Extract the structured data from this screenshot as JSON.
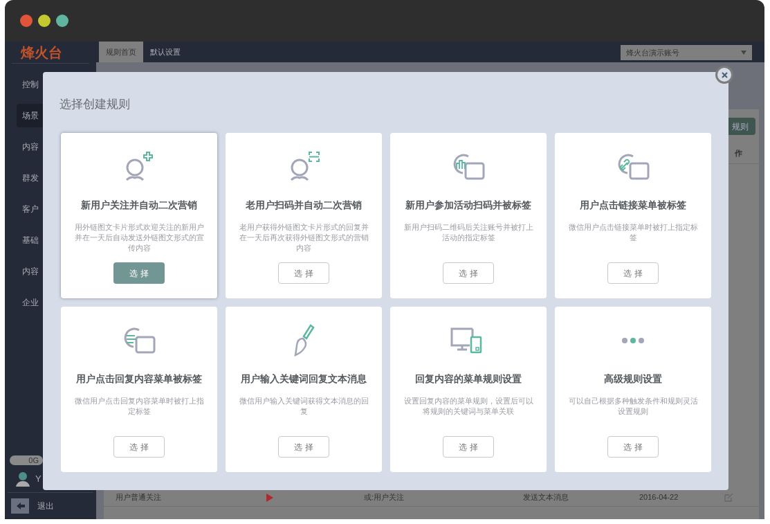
{
  "window": {
    "controls": [
      {
        "color": "#e0553a"
      },
      {
        "color": "#c4c92f"
      },
      {
        "color": "#5fb5a0"
      }
    ]
  },
  "logo": "烽火台",
  "sidebar": {
    "items": [
      {
        "label": "控制",
        "selected": false
      },
      {
        "label": "场景",
        "selected": true
      },
      {
        "label": "内容",
        "selected": false
      },
      {
        "label": "群发",
        "selected": false
      },
      {
        "label": "客户",
        "selected": false
      },
      {
        "label": "基础",
        "selected": false
      },
      {
        "label": "内容",
        "selected": false
      },
      {
        "label": "企业",
        "selected": false
      }
    ],
    "storage": "0G",
    "user": "Y",
    "logout": "退出"
  },
  "top_nav": {
    "tabs": [
      {
        "label": "规则首页",
        "selected": true
      },
      {
        "label": "默认设置",
        "selected": false
      }
    ],
    "account_select": {
      "value": "烽火台演示账号"
    }
  },
  "background": {
    "button": "规则",
    "column_header": "作",
    "row": {
      "cells": [
        "用户普通关注",
        "或:用户关注",
        "发送文本消息",
        "2016-04-22"
      ]
    }
  },
  "dialog": {
    "title": "选择创建规则",
    "cards": [
      {
        "kind": "user-plus",
        "title": "新用户关注并自动二次营销",
        "description": "用外链图文卡片形式欢迎关注的新用户并在一天后自动发送外链图文形式的宣传内容",
        "button": "选 择",
        "selected": true
      },
      {
        "kind": "user-scan",
        "title": "老用户扫码并自动二次营销",
        "description": "老用户获得外链图文卡片形式的回复并在一天后再次获得外链图文形式的营销内容",
        "button": "选 择",
        "selected": false
      },
      {
        "kind": "chart-chat",
        "title": "新用户参加活动扫码并被标签",
        "description": "新用户扫码二维码后关注账号并被打上活动的指定标签",
        "button": "选 择",
        "selected": false
      },
      {
        "kind": "link-chat",
        "title": "用户点击链接菜单被标签",
        "description": "微信用户点击链接菜单时被打上指定标签",
        "button": "选 择",
        "selected": false
      },
      {
        "kind": "text-chat",
        "title": "用户点击回复内容菜单被标签",
        "description": "微信用户点击回复内容菜单时被打上指定标签",
        "button": "选 择",
        "selected": false
      },
      {
        "kind": "brush",
        "title": "用户输入关键词回复文本消息",
        "description": "微信用户输入关键词获得文本消息的回复",
        "button": "选 择",
        "selected": false
      },
      {
        "kind": "devices",
        "title": "回复内容的菜单规则设置",
        "description": "设置回复内容的菜单规则，设置后可以将规则的关键词与菜单关联",
        "button": "选 择",
        "selected": false
      },
      {
        "kind": "dots",
        "title": "高级规则设置",
        "description": "可以自己根据多种触发条件和规则灵活设置规则",
        "button": "选 择",
        "selected": false
      }
    ]
  }
}
